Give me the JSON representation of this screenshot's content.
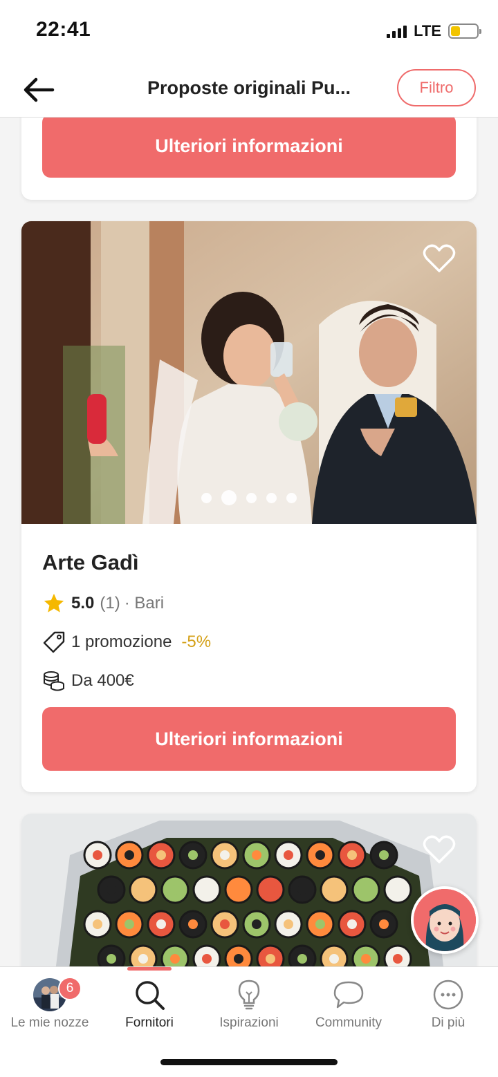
{
  "status_bar": {
    "time": "22:41",
    "network": "LTE",
    "battery_level": 0.35,
    "battery_color": "#f2c400"
  },
  "header": {
    "title": "Proposte originali Pu...",
    "back_icon": "arrow-left-icon",
    "filter_label": "Filtro"
  },
  "cards": [
    {
      "cta_label": "Ulteriori informazioni"
    },
    {
      "name": "Arte Gadì",
      "rating": "5.0",
      "reviews": "(1)",
      "location": "· Bari",
      "promotion": "1 promozione",
      "discount": "-5%",
      "price": "Da 400€",
      "cta_label": "Ulteriori informazioni",
      "photo_count": 5,
      "active_photo_index": 1,
      "favorite_icon": "heart-outline-icon"
    },
    {
      "favorite_icon": "heart-outline-icon"
    }
  ],
  "bottom_nav": {
    "active": "Fornitori",
    "items": [
      {
        "label": "Le mie nozze",
        "icon": "avatar-icon",
        "badge": "6"
      },
      {
        "label": "Fornitori",
        "icon": "search-icon"
      },
      {
        "label": "Ispirazioni",
        "icon": "lightbulb-icon"
      },
      {
        "label": "Community",
        "icon": "chat-bubble-icon"
      },
      {
        "label": "Di più",
        "icon": "more-icon"
      }
    ]
  },
  "colors": {
    "accent": "#f06b6b",
    "discount": "#d4a017",
    "star": "#f5b800"
  }
}
